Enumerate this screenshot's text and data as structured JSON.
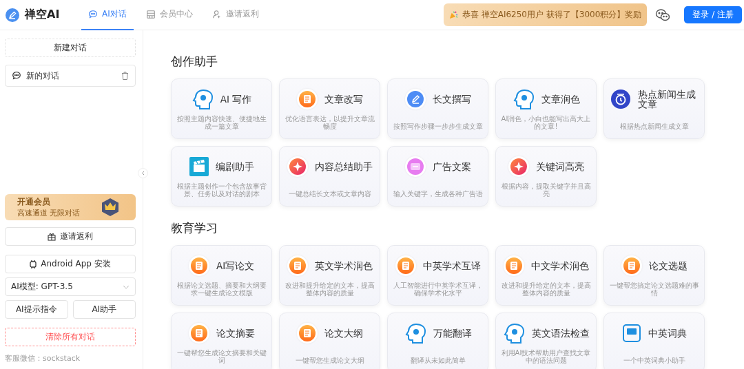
{
  "header": {
    "logo": "禅空AI",
    "tabs": [
      {
        "label": "AI对话",
        "selected": true
      },
      {
        "label": "会员中心",
        "selected": false
      },
      {
        "label": "邀请返利",
        "selected": false
      }
    ],
    "notice": "恭喜 禅空AI6250用户 获得了【3000积分】奖励",
    "login": "登录 / 注册"
  },
  "sidebar": {
    "new_chat": "新建对话",
    "conversations": [
      {
        "title": "新的对话"
      }
    ],
    "vip": {
      "title": "开通会员",
      "subtitle": "高速通道 无限对话"
    },
    "invite": "邀请返利",
    "android": "Android App 安装",
    "model": "AI模型: GPT-3.5",
    "prompt_button": "AI提示指令",
    "assistant_button": "AI助手",
    "clear": "清除所有对话",
    "support": "客服微信：sockstack"
  },
  "sections": [
    {
      "title": "创作助手",
      "cards": [
        {
          "title": "AI 写作",
          "description": "按照主题内容快速、便捷地生成一篇文章",
          "kind": "head"
        },
        {
          "title": "文章改写",
          "description": "优化语言表达，以提升文章流畅度",
          "kind": "doc"
        },
        {
          "title": "长文撰写",
          "description": "按照写作步骤一步步生成文章",
          "kind": "pen"
        },
        {
          "title": "文章润色",
          "description": "AI润色，小白也能写出高大上的文章!",
          "kind": "head"
        },
        {
          "title": "热点新闻生成文章",
          "description": "根据热点新闻生成文章",
          "kind": "news"
        },
        {
          "title": "编剧助手",
          "description": "根据主题创作一个包含故事背景、任务以及对话的剧本",
          "kind": "clapper"
        },
        {
          "title": "内容总结助手",
          "description": "一键总结长文本或文章内容",
          "kind": "badge"
        },
        {
          "title": "广告文案",
          "description": "输入关键字，生成各种广告语",
          "kind": "ad"
        },
        {
          "title": "关键词高亮",
          "description": "根据内容，提取关键字并且高亮",
          "kind": "badge"
        }
      ]
    },
    {
      "title": "教育学习",
      "cards": [
        {
          "title": "AI写论文",
          "description": "根据论文选题、摘要和大纲要求一键生成论文模版",
          "kind": "doc"
        },
        {
          "title": "英文学术润色",
          "description": "改进和提升给定的文本，提高整体内容的质量",
          "kind": "doc"
        },
        {
          "title": "中英学术互译",
          "description": "人工智能进行中英学术互译，确保学术化水平",
          "kind": "doc"
        },
        {
          "title": "中文学术润色",
          "description": "改进和提升给定的文本，提高整体内容的质量",
          "kind": "doc"
        },
        {
          "title": "论文选题",
          "description": "一键帮您搞定论文选题难的事情",
          "kind": "doc"
        },
        {
          "title": "论文摘要",
          "description": "一键帮您生成论文摘要和关键词",
          "kind": "doc"
        },
        {
          "title": "论文大纲",
          "description": "一键帮您生成论文大纲",
          "kind": "doc"
        },
        {
          "title": "万能翻译",
          "description": "翻译从未如此简单",
          "kind": "head"
        },
        {
          "title": "英文语法检查",
          "description": "利用AI技术帮助用户查找文章中的语法问题",
          "kind": "head"
        },
        {
          "title": "中英词典",
          "description": "一个中英词典小助手",
          "kind": "dict"
        }
      ]
    }
  ]
}
